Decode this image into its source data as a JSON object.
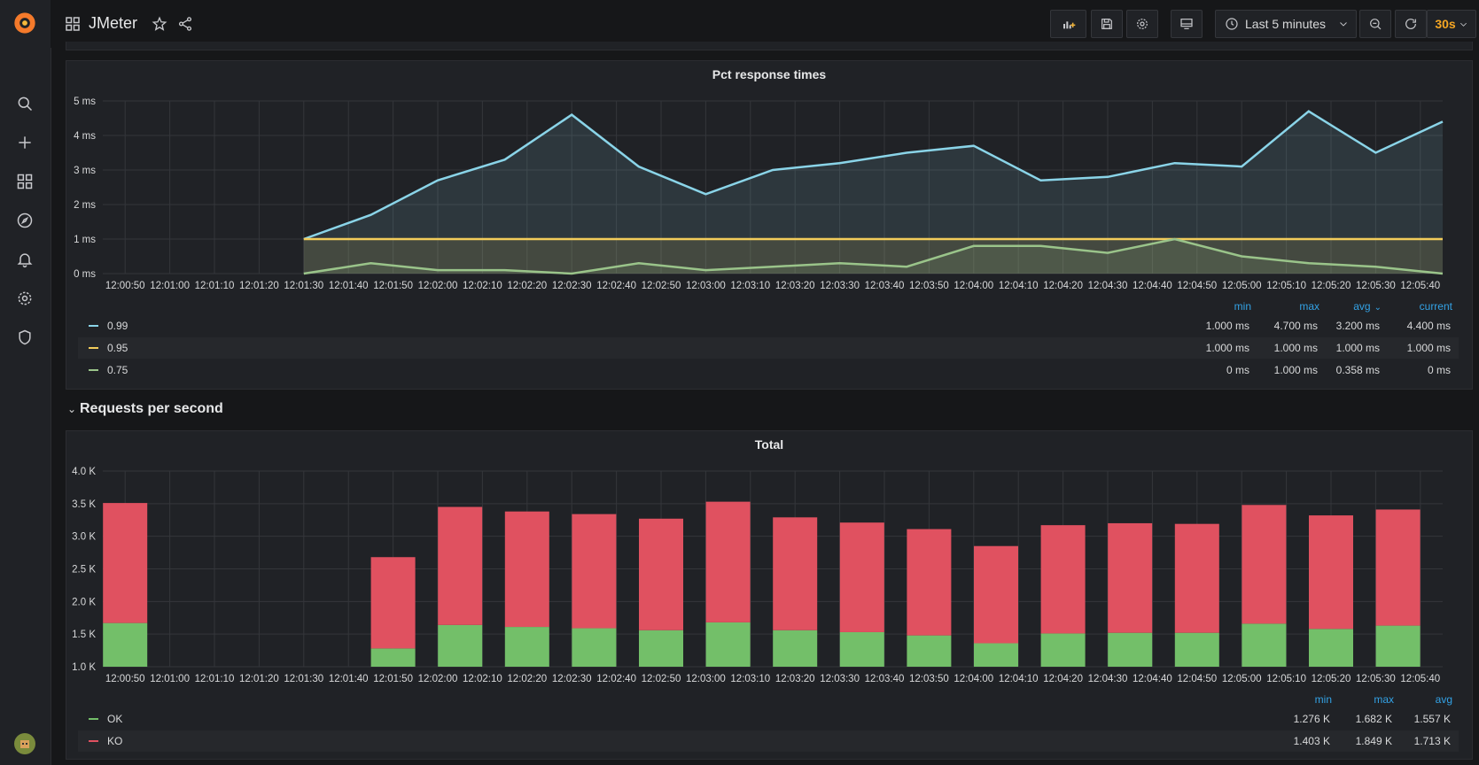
{
  "header": {
    "dashboard_title": "JMeter",
    "time_range": "Last 5 minutes",
    "refresh_interval": "30s"
  },
  "sidebar": {
    "items": [
      "logo",
      "search",
      "create",
      "dashboards",
      "explore",
      "alerting",
      "configuration",
      "server-admin",
      "user-avatar"
    ]
  },
  "colors": {
    "p99": "#8ad4e8",
    "p95": "#f2cc5b",
    "p75": "#9ac48a",
    "ok": "#73bf69",
    "ko": "#e05160",
    "legend_header": "#33a2e5"
  },
  "panel1": {
    "title": "Pct response times",
    "legend_headers": [
      "min",
      "max",
      "avg",
      "current"
    ],
    "legend": [
      {
        "name": "0.99",
        "min": "1.000 ms",
        "max": "4.700 ms",
        "avg": "3.200 ms",
        "current": "4.400 ms"
      },
      {
        "name": "0.95",
        "min": "1.000 ms",
        "max": "1.000 ms",
        "avg": "1.000 ms",
        "current": "1.000 ms"
      },
      {
        "name": "0.75",
        "min": "0 ms",
        "max": "1.000 ms",
        "avg": "0.358 ms",
        "current": "0 ms"
      }
    ]
  },
  "section": {
    "title": "Requests per second"
  },
  "panel2": {
    "title": "Total",
    "legend_headers": [
      "min",
      "max",
      "avg"
    ],
    "legend": [
      {
        "name": "OK",
        "min": "1.276 K",
        "max": "1.682 K",
        "avg": "1.557 K"
      },
      {
        "name": "KO",
        "min": "1.403 K",
        "max": "1.849 K",
        "avg": "1.713 K"
      }
    ]
  },
  "chart_data": [
    {
      "type": "line",
      "title": "Pct response times",
      "x": [
        "12:01:30",
        "12:01:40",
        "12:01:50",
        "12:02:00",
        "12:02:10",
        "12:02:20",
        "12:02:30",
        "12:02:40",
        "12:02:50",
        "12:03:00",
        "12:03:10",
        "12:03:20",
        "12:03:30",
        "12:03:40",
        "12:03:50",
        "12:04:00",
        "12:04:10",
        "12:04:20",
        "12:04:30",
        "12:04:40",
        "12:04:50",
        "12:05:00",
        "12:05:10",
        "12:05:20",
        "12:05:30",
        "12:05:40",
        "12:05:45"
      ],
      "x_ticks": [
        "12:00:50",
        "12:01:00",
        "12:01:10",
        "12:01:20",
        "12:01:30",
        "12:01:40",
        "12:01:50",
        "12:02:00",
        "12:02:10",
        "12:02:20",
        "12:02:30",
        "12:02:40",
        "12:02:50",
        "12:03:00",
        "12:03:10",
        "12:03:20",
        "12:03:30",
        "12:03:40",
        "12:03:50",
        "12:04:00",
        "12:04:10",
        "12:04:20",
        "12:04:30",
        "12:04:40",
        "12:04:50",
        "12:05:00",
        "12:05:10",
        "12:05:20",
        "12:05:30",
        "12:05:40"
      ],
      "y_ticks": [
        "0 ms",
        "1 ms",
        "2 ms",
        "3 ms",
        "4 ms",
        "5 ms"
      ],
      "ylim": [
        0,
        5
      ],
      "xlim_start": "12:00:45",
      "xlim_end": "12:05:45",
      "series": [
        {
          "name": "0.99",
          "values": [
            1.0,
            1.7,
            2.7,
            3.3,
            4.6,
            3.1,
            2.3,
            3.0,
            3.2,
            3.5,
            3.7,
            2.7,
            2.8,
            3.2,
            3.1,
            4.7,
            3.5,
            4.4
          ],
          "x_index": [
            0,
            2,
            4,
            6,
            8,
            10,
            12,
            14,
            16,
            18,
            20,
            22,
            24,
            26,
            28,
            30,
            32,
            34
          ]
        },
        {
          "name": "0.95",
          "values": [
            1,
            1,
            1,
            1,
            1,
            1,
            1,
            1,
            1,
            1,
            1,
            1,
            1,
            1,
            1,
            1,
            1,
            1
          ],
          "x_index": [
            0,
            2,
            4,
            6,
            8,
            10,
            12,
            14,
            16,
            18,
            20,
            22,
            24,
            26,
            28,
            30,
            32,
            34
          ]
        },
        {
          "name": "0.75",
          "values": [
            0,
            0.3,
            0.1,
            0.1,
            0,
            0.3,
            0.1,
            0.2,
            0.3,
            0.2,
            0.8,
            0.8,
            0.6,
            1.0,
            0.5,
            0.3,
            0.2,
            0
          ],
          "x_index": [
            0,
            2,
            4,
            6,
            8,
            10,
            12,
            14,
            16,
            18,
            20,
            22,
            24,
            26,
            28,
            30,
            32,
            34
          ]
        }
      ]
    },
    {
      "type": "bar",
      "title": "Total",
      "stacked": true,
      "x_ticks": [
        "12:00:50",
        "12:01:00",
        "12:01:10",
        "12:01:20",
        "12:01:30",
        "12:01:40",
        "12:01:50",
        "12:02:00",
        "12:02:10",
        "12:02:20",
        "12:02:30",
        "12:02:40",
        "12:02:50",
        "12:03:00",
        "12:03:10",
        "12:03:20",
        "12:03:30",
        "12:03:40",
        "12:03:50",
        "12:04:00",
        "12:04:10",
        "12:04:20",
        "12:04:30",
        "12:04:40",
        "12:04:50",
        "12:05:00",
        "12:05:10",
        "12:05:20",
        "12:05:30",
        "12:05:40"
      ],
      "y_ticks": [
        "1.0 K",
        "1.5 K",
        "2.0 K",
        "2.5 K",
        "3.0 K",
        "3.5 K",
        "4.0 K"
      ],
      "ylim": [
        1.0,
        4.0
      ],
      "bar_times_sec": [
        0,
        60,
        75,
        90,
        105,
        120,
        135,
        150,
        165,
        180,
        195,
        210,
        225,
        240,
        255,
        270,
        285,
        300
      ],
      "series": [
        {
          "name": "OK",
          "values": [
            1.67,
            1.28,
            1.64,
            1.61,
            1.59,
            1.56,
            1.68,
            1.56,
            1.53,
            1.48,
            1.36,
            1.51,
            1.52,
            1.52,
            1.66,
            1.58,
            1.63,
            1.64
          ]
        },
        {
          "name": "KO",
          "values": [
            1.84,
            1.4,
            1.81,
            1.77,
            1.75,
            1.71,
            1.85,
            1.73,
            1.68,
            1.63,
            1.49,
            1.66,
            1.68,
            1.67,
            1.82,
            1.74,
            1.78,
            1.8
          ]
        }
      ]
    }
  ]
}
